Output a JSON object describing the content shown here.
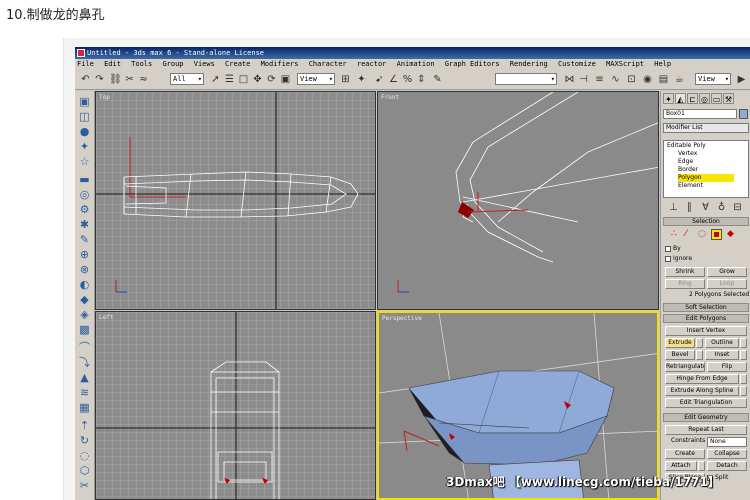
{
  "page": {
    "step_title": "10.制做龙的鼻孔",
    "watermark": "3Dmax吧 【www.linecg.com/tieba/1771】"
  },
  "window": {
    "title": "Untitled - 3ds max 6 - Stand-alone License",
    "menu": [
      "File",
      "Edit",
      "Tools",
      "Group",
      "Views",
      "Create",
      "Modifiers",
      "Character",
      "reactor",
      "Animation",
      "Graph Editors",
      "Rendering",
      "Customize",
      "MAXScript",
      "Help"
    ]
  },
  "toolbar": {
    "selection_filter": "All",
    "ref_coord": "View",
    "named_selection": "",
    "render_view": "View"
  },
  "viewports": {
    "top": "Top",
    "front": "Front",
    "left": "Left",
    "perspective": "Perspective"
  },
  "command_panel": {
    "object_name": "Box01",
    "modifier_list": "Modifier List",
    "stack": [
      {
        "label": "Editable Poly",
        "selected": false
      },
      {
        "label": "Vertex",
        "selected": false
      },
      {
        "label": "Edge",
        "selected": false
      },
      {
        "label": "Border",
        "selected": false
      },
      {
        "label": "Polygon",
        "selected": true
      },
      {
        "label": "Element",
        "selected": false
      }
    ],
    "selection": {
      "header": "Selection",
      "by_label": "By",
      "ignore_label": "Ignore",
      "shrink": "Shrink",
      "grow": "Grow",
      "ring": "Ring",
      "loop": "Loop",
      "status": "2 Polygons Selected"
    },
    "soft_selection": "Soft Selection",
    "edit_polygons": {
      "header": "Edit Polygons",
      "insert_vertex": "Insert Vertex",
      "extrude": "Extrude",
      "outline": "Outline",
      "bevel": "Bevel",
      "inset": "Inset",
      "retriangulate": "Retriangulate",
      "flip": "Flip",
      "hinge_from_edge": "Hinge From Edge",
      "extrude_along_spline": "Extrude Along Spline",
      "edit_triangulation": "Edit Triangulation"
    },
    "edit_geometry": {
      "header": "Edit Geometry",
      "repeat_last": "Repeat Last",
      "constraints_label": "Constraints",
      "constraints_value": "None",
      "create": "Create",
      "collapse": "Collapse",
      "attach": "Attach",
      "detach": "Detach",
      "slice_plane": "Slice Plane",
      "split": "Split"
    }
  },
  "colors": {
    "selected_polygon": "#c00000",
    "active_border": "#f0e000",
    "mesh_blue": "#8fa9d8",
    "highlight": "#f7e600"
  }
}
